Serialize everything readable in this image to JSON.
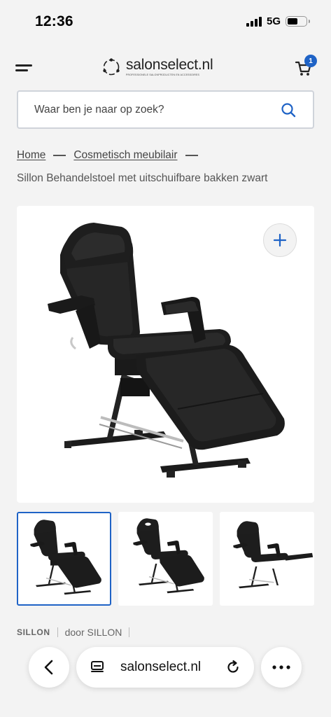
{
  "status_bar": {
    "time": "12:36",
    "network": "5G",
    "battery_level": 0.55
  },
  "header": {
    "logo_text": "salonselect.nl",
    "logo_tagline": "PROFESSIONELE SALONPRODUCTEN EN ACCESSOIRES",
    "cart_count": "1",
    "brand_color": "#1f63c6"
  },
  "search": {
    "placeholder": "Waar ben je naar op zoek?"
  },
  "breadcrumb": {
    "items": [
      "Home",
      "Cosmetisch meubilair"
    ],
    "current": "Sillon Behandelstoel met uitschuifbare bakken zwart"
  },
  "gallery": {
    "zoom_icon": "plus-icon",
    "thumbnail_count": 3,
    "active_thumbnail": 1
  },
  "meta": {
    "brand": "SILLON",
    "by_label": "door SILLON"
  },
  "browser": {
    "url": "salonselect.nl",
    "icons": [
      "back-arrow-icon",
      "tabs-icon",
      "reload-icon",
      "more-icon"
    ]
  }
}
